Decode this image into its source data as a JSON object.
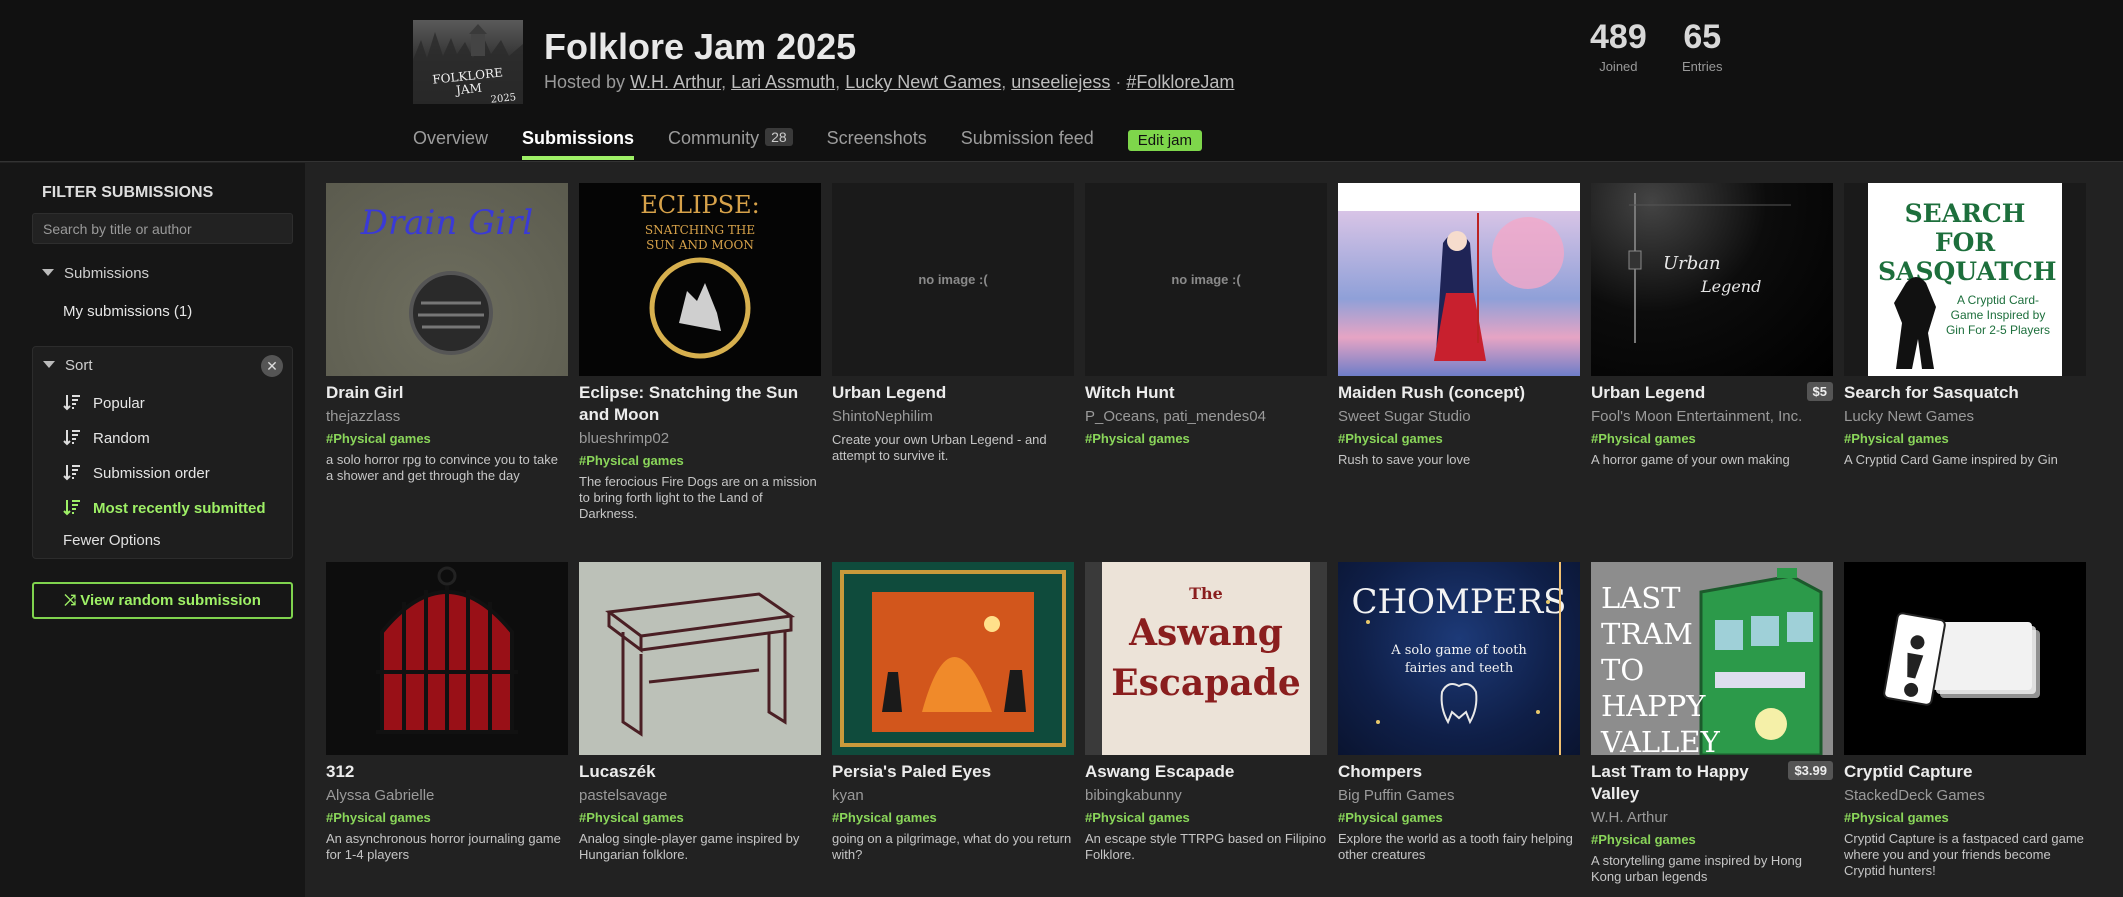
{
  "jam": {
    "cover_text_line1": "FOLKLORE JAM",
    "cover_text_line2": "2025",
    "title": "Folklore Jam 2025",
    "hosted_prefix": "Hosted by",
    "hosts": [
      "W.H. Arthur",
      "Lari Assmuth",
      "Lucky Newt Games",
      "unseeliejess"
    ],
    "separator": ",",
    "dot": "·",
    "hashtag": "#FolkloreJam",
    "stats": [
      {
        "value": "489",
        "label": "Joined"
      },
      {
        "value": "65",
        "label": "Entries"
      }
    ]
  },
  "nav": {
    "overview": "Overview",
    "submissions": "Submissions",
    "community": "Community",
    "community_count": "28",
    "screenshots": "Screenshots",
    "submission_feed": "Submission feed",
    "edit_jam": "Edit jam"
  },
  "sidebar": {
    "filter_title": "FILTER SUBMISSIONS",
    "search_placeholder": "Search by title or author",
    "submissions_heading": "Submissions",
    "my_submissions": "My submissions (1)",
    "sort_heading": "Sort",
    "close_glyph": "✕",
    "sort_options": [
      "Popular",
      "Random",
      "Submission order",
      "Most recently submitted"
    ],
    "active_sort": "Most recently submitted",
    "fewer_options": "Fewer Options",
    "random_button": "View random submission",
    "shuffle_glyph": "⤨"
  },
  "colors": {
    "accent_green": "#9ef066",
    "tag_green": "#8ad65a",
    "header_bg": "#111111",
    "page_bg": "#222222"
  },
  "no_image_text": "no image :(",
  "submissions": [
    {
      "title": "Drain Girl",
      "author": "thejazzlass",
      "tag": "#Physical games",
      "desc": "a solo horror rpg to convince you to take a shower and get through the day",
      "price": "",
      "thumb": "drain",
      "thumb_text": "Drain Girl"
    },
    {
      "title": "Eclipse: Snatching the Sun and Moon",
      "author": "blueshrimp02",
      "tag": "#Physical games",
      "desc": "The ferocious Fire Dogs are on a mission to bring forth light to the Land of Darkness.",
      "price": "",
      "thumb": "eclipse",
      "thumb_text": "ECLIPSE:",
      "thumb_sub": "SNATCHING THE SUN AND MOON"
    },
    {
      "title": "Urban Legend",
      "author": "ShintoNephilim",
      "tag": "",
      "desc": "Create your own Urban Legend - and attempt to survive it.",
      "price": "",
      "thumb": "none"
    },
    {
      "title": "Witch Hunt",
      "author": "P_Oceans, pati_mendes04",
      "tag": "#Physical games",
      "desc": "",
      "price": "",
      "thumb": "none"
    },
    {
      "title": "Maiden Rush (concept)",
      "author": "Sweet Sugar Studio",
      "tag": "#Physical games",
      "desc": "Rush to save your love",
      "price": "",
      "thumb": "maiden"
    },
    {
      "title": "Urban Legend",
      "author": "Fool's Moon Entertainment, Inc.",
      "tag": "#Physical games",
      "desc": "A horror game of your own making",
      "price": "$5",
      "thumb": "urban",
      "thumb_text": "Urban",
      "thumb_sub": "Legend"
    },
    {
      "title": "Search for Sasquatch",
      "author": "Lucky Newt Games",
      "tag": "#Physical games",
      "desc": "A Cryptid Card Game inspired by Gin",
      "price": "",
      "thumb": "sasquatch",
      "thumb_text": "SEARCH FOR SASQUATCH",
      "thumb_sub": "A Cryptid Card-Game Inspired by Gin For 2-5 Players"
    },
    {
      "title": "312",
      "author": "Alyssa Gabrielle",
      "tag": "#Physical games",
      "desc": "An asynchronous horror journaling game for 1-4 players",
      "price": "",
      "thumb": "cage"
    },
    {
      "title": "Lucaszék",
      "author": "pastelsavage",
      "tag": "#Physical games",
      "desc": "Analog single-player game inspired by Hungarian folklore.",
      "price": "",
      "thumb": "stool"
    },
    {
      "title": "Persia's Paled Eyes",
      "author": "kyan",
      "tag": "#Physical games",
      "desc": "going on a pilgrimage, what do you return with?",
      "price": "",
      "thumb": "persia"
    },
    {
      "title": "Aswang Escapade",
      "author": "bibingkabunny",
      "tag": "#Physical games",
      "desc": "An escape style TTRPG based on Filipino Folklore.",
      "price": "",
      "thumb": "aswang",
      "thumb_text": "The",
      "thumb_sub": "Aswang",
      "thumb_sub2": "Escapade"
    },
    {
      "title": "Chompers",
      "author": "Big Puffin Games",
      "tag": "#Physical games",
      "desc": "Explore the world as a tooth fairy helping other creatures",
      "price": "",
      "thumb": "chompers",
      "thumb_text": "CHOMPERS",
      "thumb_sub": "A solo game of tooth fairies and teeth"
    },
    {
      "title": "Last Tram to Happy Valley",
      "author": "W.H. Arthur",
      "tag": "#Physical games",
      "desc": "A storytelling game inspired by Hong Kong urban legends",
      "price": "$3.99",
      "thumb": "tram",
      "thumb_text": "LAST TRAM TO HAPPY VALLEY"
    },
    {
      "title": "Cryptid Capture",
      "author": "StackedDeck Games",
      "tag": "#Physical games",
      "desc": "Cryptid Capture is a fastpaced card game where you and your friends become Cryptid hunters!",
      "price": "",
      "thumb": "cryptid"
    }
  ]
}
